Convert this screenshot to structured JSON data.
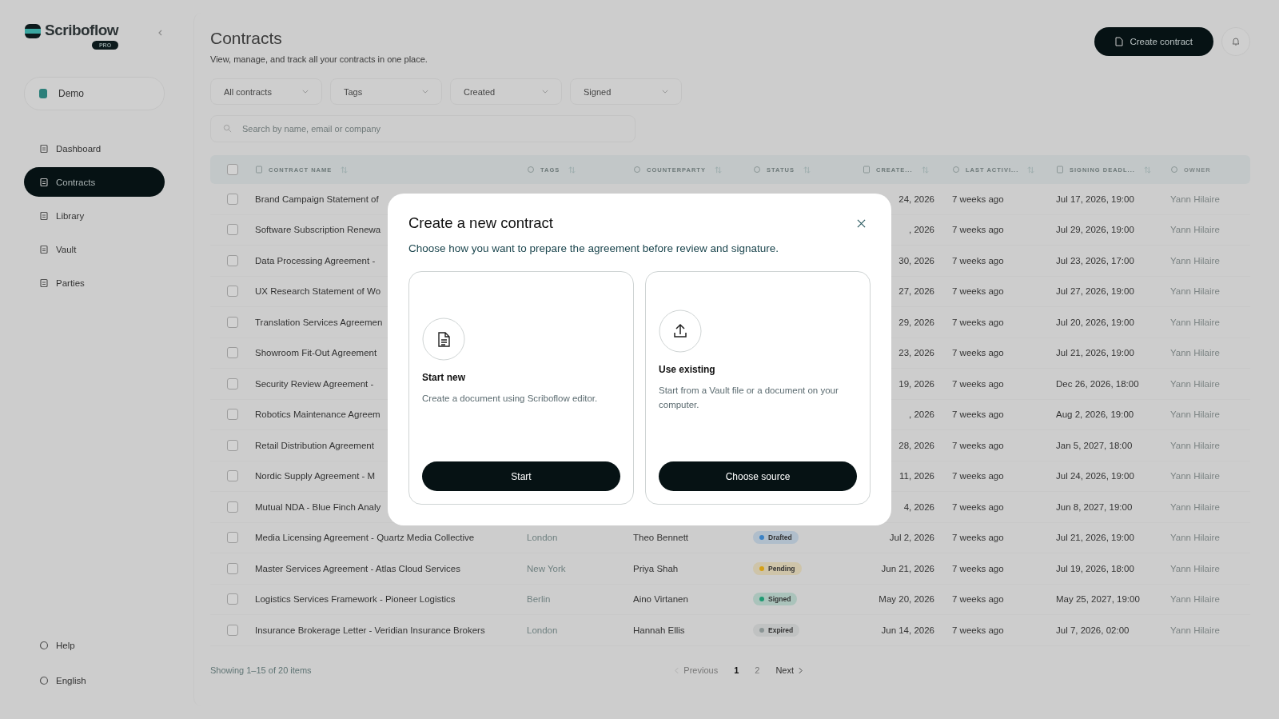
{
  "sidebar": {
    "brand": "Scriboflow",
    "badge": "PRO",
    "workspace": "Demo",
    "items": [
      {
        "label": "Dashboard",
        "selected": false
      },
      {
        "label": "Contracts",
        "selected": true
      },
      {
        "label": "Library",
        "selected": false
      },
      {
        "label": "Vault",
        "selected": false
      },
      {
        "label": "Parties",
        "selected": false
      }
    ],
    "footer_items": [
      {
        "label": "Help"
      },
      {
        "label": "English"
      }
    ]
  },
  "header": {
    "title": "Contracts",
    "subtitle": "View, manage, and track all your contracts in one place.",
    "create_button": "Create contract"
  },
  "filters": [
    {
      "label": "All contracts"
    },
    {
      "label": "Tags"
    },
    {
      "label": "Created"
    },
    {
      "label": "Signed"
    }
  ],
  "search": {
    "placeholder": "Search by name, email or company"
  },
  "table": {
    "header_checked": false,
    "columns": [
      "CONTRACT NAME",
      "TAGS",
      "COUNTERPARTY",
      "STATUS",
      "CREATE...",
      "LAST ACTIVI...",
      "SIGNING DEADL...",
      "OWNER"
    ],
    "rows": [
      {
        "checked": false,
        "name": "Brand Campaign Statement of",
        "created": "24, 2026",
        "last_activity": "7 weeks ago",
        "signing_deadline": "Jul 17, 2026, 19:00",
        "owner": "Yann Hilaire"
      },
      {
        "checked": false,
        "name": "Software Subscription Renewa",
        "created": ", 2026",
        "last_activity": "7 weeks ago",
        "signing_deadline": "Jul 29, 2026, 19:00",
        "owner": "Yann Hilaire"
      },
      {
        "checked": false,
        "name": "Data Processing Agreement -",
        "created": "30, 2026",
        "last_activity": "7 weeks ago",
        "signing_deadline": "Jul 23, 2026, 17:00",
        "owner": "Yann Hilaire"
      },
      {
        "checked": false,
        "name": "UX Research Statement of Wo",
        "created": "27, 2026",
        "last_activity": "7 weeks ago",
        "signing_deadline": "Jul 27, 2026, 19:00",
        "owner": "Yann Hilaire"
      },
      {
        "checked": false,
        "name": "Translation Services Agreemen",
        "created": "29, 2026",
        "last_activity": "7 weeks ago",
        "signing_deadline": "Jul 20, 2026, 19:00",
        "owner": "Yann Hilaire"
      },
      {
        "checked": false,
        "name": "Showroom Fit-Out Agreement",
        "created": "23, 2026",
        "last_activity": "7 weeks ago",
        "signing_deadline": "Jul 21, 2026, 19:00",
        "owner": "Yann Hilaire"
      },
      {
        "checked": false,
        "name": "Security Review Agreement -",
        "created": "19, 2026",
        "last_activity": "7 weeks ago",
        "signing_deadline": "Dec 26, 2026, 18:00",
        "owner": "Yann Hilaire"
      },
      {
        "checked": false,
        "name": "Robotics Maintenance Agreem",
        "created": ", 2026",
        "last_activity": "7 weeks ago",
        "signing_deadline": "Aug 2, 2026, 19:00",
        "owner": "Yann Hilaire"
      },
      {
        "checked": false,
        "name": "Retail Distribution Agreement",
        "created": "28, 2026",
        "last_activity": "7 weeks ago",
        "signing_deadline": "Jan 5, 2027, 18:00",
        "owner": "Yann Hilaire"
      },
      {
        "checked": false,
        "name": "Nordic Supply Agreement - M",
        "created": "11, 2026",
        "last_activity": "7 weeks ago",
        "signing_deadline": "Jul 24, 2026, 19:00",
        "owner": "Yann Hilaire"
      },
      {
        "checked": false,
        "name": "Mutual NDA - Blue Finch Analy",
        "created": "4, 2026",
        "last_activity": "7 weeks ago",
        "signing_deadline": "Jun 8, 2027, 19:00",
        "owner": "Yann Hilaire"
      },
      {
        "checked": false,
        "name": "Media Licensing Agreement - Quartz Media Collective",
        "tag": "London",
        "counterparty": "Theo Bennett",
        "status": {
          "label": "Drafted",
          "color": "#3b82c4"
        },
        "created": "Jul 2, 2026",
        "last_activity": "7 weeks ago",
        "signing_deadline": "Jul 21, 2026, 19:00",
        "owner": "Yann Hilaire"
      },
      {
        "checked": false,
        "name": "Master Services Agreement - Atlas Cloud Services",
        "tag": "New York",
        "counterparty": "Priya Shah",
        "status": {
          "label": "Pending",
          "color": "#d4a017"
        },
        "created": "Jun 21, 2026",
        "last_activity": "7 weeks ago",
        "signing_deadline": "Jul 19, 2026, 18:00",
        "owner": "Yann Hilaire"
      },
      {
        "checked": false,
        "name": "Logistics Services Framework - Pioneer Logistics",
        "tag": "Berlin",
        "counterparty": "Aino Virtanen",
        "status": {
          "label": "Signed",
          "color": "#1f9a72"
        },
        "created": "May 20, 2026",
        "last_activity": "7 weeks ago",
        "signing_deadline": "May 25, 2027, 19:00",
        "owner": "Yann Hilaire"
      },
      {
        "checked": false,
        "name": "Insurance Brokerage Letter - Veridian Insurance Brokers",
        "tag": "London",
        "counterparty": "Hannah Ellis",
        "status": {
          "label": "Expired",
          "color": "#8a9494"
        },
        "created": "Jun 14, 2026",
        "last_activity": "7 weeks ago",
        "signing_deadline": "Jul 7, 2026, 02:00",
        "owner": "Yann Hilaire"
      }
    ]
  },
  "footer": {
    "showing": "Showing 1–15 of 20 items",
    "previous": "Previous",
    "pages": [
      {
        "label": "1",
        "selected": true
      },
      {
        "label": "2",
        "selected": false
      }
    ],
    "next": "Next"
  },
  "modal": {
    "title": "Create a new contract",
    "subtitle": "Choose how you want to prepare the agreement before review and signature.",
    "options": [
      {
        "kind": "new",
        "title": "Start new",
        "description": "Create a document using Scriboflow editor.",
        "button": "Start"
      },
      {
        "kind": "existing",
        "title": "Use existing",
        "description": "Start from a Vault file or a document on your computer.",
        "button": "Choose source"
      }
    ]
  }
}
